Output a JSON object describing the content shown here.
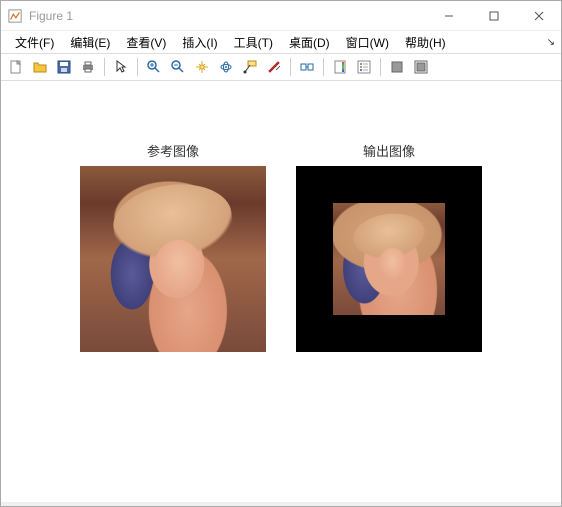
{
  "window": {
    "title": "Figure 1"
  },
  "menu": {
    "file": "文件(F)",
    "edit": "编辑(E)",
    "view": "查看(V)",
    "insert": "插入(I)",
    "tools": "工具(T)",
    "desktop": "桌面(D)",
    "window": "窗口(W)",
    "help": "帮助(H)"
  },
  "toolbar": {
    "icons": [
      "new-figure",
      "open",
      "save",
      "print",
      "pointer",
      "zoom-in",
      "zoom-out",
      "pan",
      "rotate3d",
      "data-cursor",
      "brush",
      "link-axes",
      "insert-colorbar",
      "insert-legend",
      "hide-plottools",
      "show-plottools"
    ]
  },
  "plots": {
    "left_title": "参考图像",
    "right_title": "输出图像"
  }
}
